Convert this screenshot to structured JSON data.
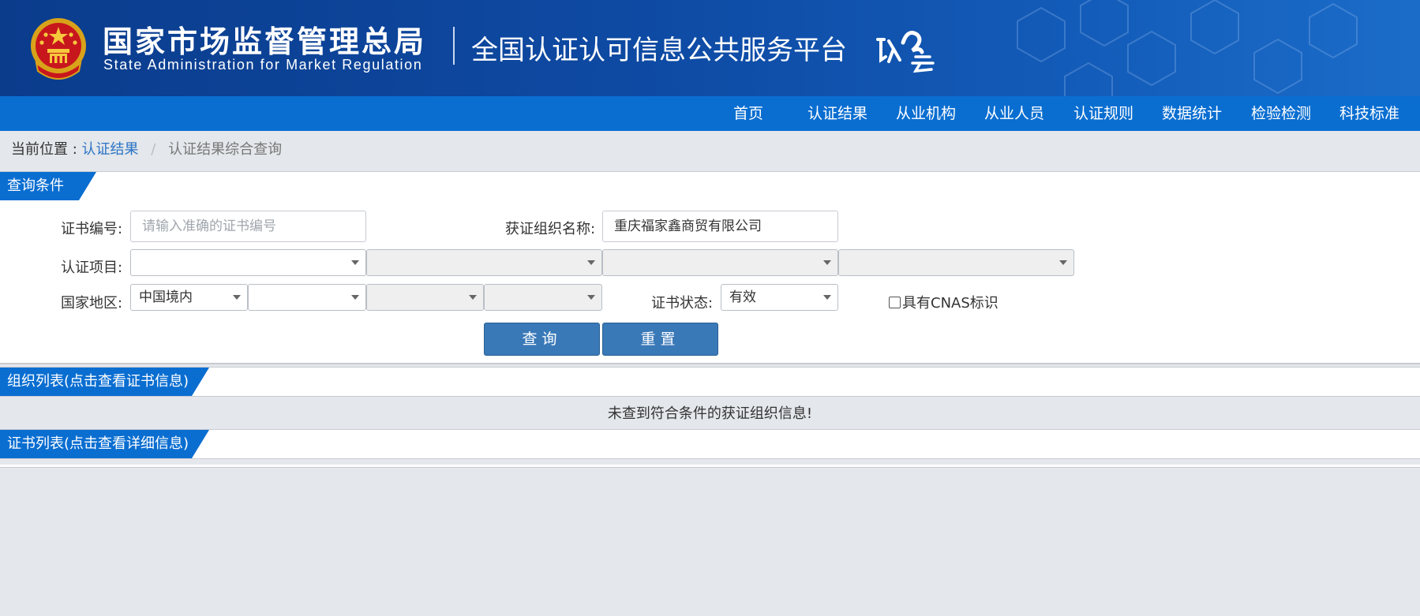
{
  "header": {
    "org_name_cn": "国家市场监督管理总局",
    "org_name_en": "State Administration  for  Market Regulation",
    "platform_title": "全国认证认可信息公共服务平台",
    "logo_text": "认云"
  },
  "nav": {
    "items": [
      {
        "label": "首页"
      },
      {
        "label": "认证结果"
      },
      {
        "label": "从业机构"
      },
      {
        "label": "从业人员"
      },
      {
        "label": "认证规则"
      },
      {
        "label": "数据统计"
      },
      {
        "label": "检验检测"
      },
      {
        "label": "科技标准"
      }
    ]
  },
  "breadcrumb": {
    "prefix": "当前位置 :",
    "link": "认证结果",
    "separator": "/",
    "current": "认证结果综合查询"
  },
  "query": {
    "section_title": "查询条件",
    "cert_no_label": "证书编号:",
    "cert_no_placeholder": "请输入准确的证书编号",
    "cert_no_value": "",
    "org_name_label": "获证组织名称:",
    "org_name_value": "重庆福家鑫商贸有限公司",
    "cert_item_label": "认证项目:",
    "country_label": "国家地区:",
    "country_value": "中国境内",
    "status_label": "证书状态:",
    "status_value": "有效",
    "cnas_label": "具有CNAS标识",
    "search_button": "查询",
    "reset_button": "重置"
  },
  "org_list": {
    "section_title": "组织列表(点击查看证书信息)",
    "empty_message": "未查到符合条件的获证组织信息!"
  },
  "cert_list": {
    "section_title": "证书列表(点击查看详细信息)"
  },
  "colors": {
    "header_bg": "#0e4aa3",
    "nav_bg": "#0a6ed1",
    "button_bg": "#3a79b8",
    "link": "#2b74c6",
    "page_bg": "#e4e7eb"
  }
}
